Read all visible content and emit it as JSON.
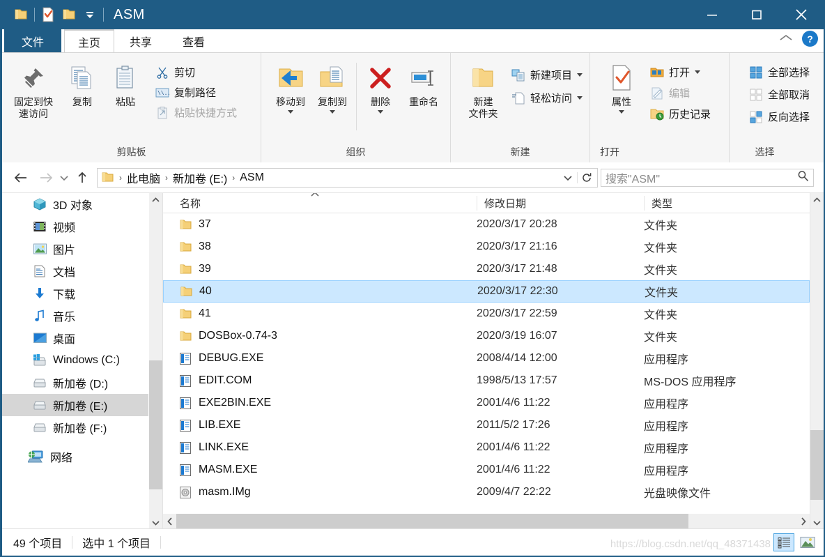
{
  "window": {
    "title": "ASM",
    "quick_access": [
      {
        "name": "folder-icon",
        "label": "属性"
      },
      {
        "name": "properties-icon",
        "label": "属性"
      },
      {
        "name": "new-folder-icon",
        "label": "新建文件夹"
      },
      {
        "name": "customize-qat-icon",
        "label": "自定义快速访问工具栏"
      }
    ],
    "controls": {
      "minimize": "最小化",
      "maximize": "最大化",
      "close": "关闭"
    }
  },
  "tabs": {
    "file": "文件",
    "items": [
      {
        "label": "主页",
        "active": true
      },
      {
        "label": "共享",
        "active": false
      },
      {
        "label": "查看",
        "active": false
      }
    ],
    "collapse_label": "折叠功能区",
    "help_label": "?"
  },
  "ribbon": {
    "groups": [
      {
        "title": "剪贴板",
        "big_buttons": [
          {
            "label": "固定到快\n速访问",
            "line1": "固定到快",
            "line2": "速访问",
            "icon": "pin-icon"
          },
          {
            "label": "复制",
            "line1": "复制",
            "line2": "",
            "icon": "copy-icon"
          },
          {
            "label": "粘贴",
            "line1": "粘贴",
            "line2": "",
            "icon": "paste-icon"
          }
        ],
        "small_buttons": [
          {
            "label": "剪切",
            "icon": "scissors-icon",
            "disabled": false
          },
          {
            "label": "复制路径",
            "icon": "copy-path-icon",
            "disabled": false
          },
          {
            "label": "粘贴快捷方式",
            "icon": "paste-shortcut-icon",
            "disabled": true
          }
        ]
      },
      {
        "title": "组织",
        "big_buttons": [
          {
            "line1": "移动到",
            "line2": "",
            "icon": "move-to-icon",
            "has_caret": true
          },
          {
            "line1": "复制到",
            "line2": "",
            "icon": "copy-to-icon",
            "has_caret": true
          },
          {
            "line1": "删除",
            "line2": "",
            "icon": "delete-icon",
            "has_caret": true
          },
          {
            "line1": "重命名",
            "line2": "",
            "icon": "rename-icon",
            "has_caret": false
          }
        ]
      },
      {
        "title": "新建",
        "big_buttons": [
          {
            "line1": "新建",
            "line2": "文件夹",
            "icon": "new-folder-icon",
            "has_caret": false
          }
        ],
        "small_buttons": [
          {
            "label": "新建项目",
            "icon": "new-item-icon",
            "has_caret": true
          },
          {
            "label": "轻松访问",
            "icon": "easy-access-icon",
            "has_caret": true
          }
        ]
      },
      {
        "title": "打开",
        "big_buttons": [
          {
            "line1": "属性",
            "line2": "",
            "icon": "properties-icon",
            "has_caret": true
          }
        ],
        "small_buttons": [
          {
            "label": "打开",
            "icon": "open-icon",
            "has_caret": true,
            "disabled": false
          },
          {
            "label": "编辑",
            "icon": "edit-icon",
            "has_caret": false,
            "disabled": true
          },
          {
            "label": "历史记录",
            "icon": "history-icon",
            "has_caret": false,
            "disabled": false
          }
        ]
      },
      {
        "title": "选择",
        "small_buttons": [
          {
            "label": "全部选择",
            "icon": "select-all-icon",
            "disabled": false
          },
          {
            "label": "全部取消",
            "icon": "select-none-icon",
            "disabled": true
          },
          {
            "label": "反向选择",
            "icon": "invert-selection-icon",
            "disabled": false
          }
        ]
      }
    ]
  },
  "addressbar": {
    "back_label": "后退",
    "forward_label": "前进",
    "recent_label": "最近浏览的位置",
    "up_label": "上移一级",
    "breadcrumbs": [
      "此电脑",
      "新加卷 (E:)",
      "ASM"
    ],
    "separator": "›",
    "dropdown_label": "先前的位置",
    "refresh_label": "刷新",
    "search_placeholder": "搜索\"ASM\""
  },
  "navpane": {
    "items": [
      {
        "label": "3D 对象",
        "icon": "3d-objects-icon",
        "selected": false
      },
      {
        "label": "视频",
        "icon": "videos-icon",
        "selected": false
      },
      {
        "label": "图片",
        "icon": "pictures-icon",
        "selected": false
      },
      {
        "label": "文档",
        "icon": "documents-icon",
        "selected": false
      },
      {
        "label": "下载",
        "icon": "downloads-icon",
        "selected": false
      },
      {
        "label": "音乐",
        "icon": "music-icon",
        "selected": false
      },
      {
        "label": "桌面",
        "icon": "desktop-icon",
        "selected": false
      },
      {
        "label": "Windows (C:)",
        "icon": "windows-drive-icon",
        "selected": false
      },
      {
        "label": "新加卷 (D:)",
        "icon": "drive-icon",
        "selected": false
      },
      {
        "label": "新加卷 (E:)",
        "icon": "drive-icon",
        "selected": true
      },
      {
        "label": "新加卷 (F:)",
        "icon": "drive-icon",
        "selected": false
      },
      {
        "label": "网络",
        "icon": "network-icon",
        "selected": false,
        "gap_before": true
      }
    ]
  },
  "filelist": {
    "columns": [
      {
        "label": "名称",
        "key": "name"
      },
      {
        "label": "修改日期",
        "key": "date"
      },
      {
        "label": "类型",
        "key": "type"
      }
    ],
    "sort_indicator": "ascending",
    "rows": [
      {
        "name": "37",
        "date": "2020/3/17 20:28",
        "type": "文件夹",
        "icon": "folder-icon",
        "selected": false
      },
      {
        "name": "38",
        "date": "2020/3/17 21:16",
        "type": "文件夹",
        "icon": "folder-icon",
        "selected": false
      },
      {
        "name": "39",
        "date": "2020/3/17 21:48",
        "type": "文件夹",
        "icon": "folder-icon",
        "selected": false
      },
      {
        "name": "40",
        "date": "2020/3/17 22:30",
        "type": "文件夹",
        "icon": "folder-icon",
        "selected": true
      },
      {
        "name": "41",
        "date": "2020/3/17 22:59",
        "type": "文件夹",
        "icon": "folder-icon",
        "selected": false
      },
      {
        "name": "DOSBox-0.74-3",
        "date": "2020/3/19 16:07",
        "type": "文件夹",
        "icon": "folder-icon",
        "selected": false
      },
      {
        "name": "DEBUG.EXE",
        "date": "2008/4/14 12:00",
        "type": "应用程序",
        "icon": "exe-icon",
        "selected": false
      },
      {
        "name": "EDIT.COM",
        "date": "1998/5/13 17:57",
        "type": "MS-DOS 应用程序",
        "icon": "exe-icon",
        "selected": false
      },
      {
        "name": "EXE2BIN.EXE",
        "date": "2001/4/6 11:22",
        "type": "应用程序",
        "icon": "exe-icon",
        "selected": false
      },
      {
        "name": "LIB.EXE",
        "date": "2011/5/2 17:26",
        "type": "应用程序",
        "icon": "exe-icon",
        "selected": false
      },
      {
        "name": "LINK.EXE",
        "date": "2001/4/6 11:22",
        "type": "应用程序",
        "icon": "exe-icon",
        "selected": false
      },
      {
        "name": "MASM.EXE",
        "date": "2001/4/6 11:22",
        "type": "应用程序",
        "icon": "exe-icon",
        "selected": false
      },
      {
        "name": "masm.IMg",
        "date": "2009/4/7 22:22",
        "type": "光盘映像文件",
        "icon": "disc-image-icon",
        "selected": false
      }
    ]
  },
  "statusbar": {
    "item_count": "49 个项目",
    "selection": "选中 1 个项目",
    "views": [
      {
        "name": "details-view",
        "label": "详细信息",
        "active": true
      },
      {
        "name": "large-icons-view",
        "label": "大图标",
        "active": false
      }
    ],
    "watermark": "https://blog.csdn.net/qq_48371438"
  },
  "colors": {
    "titlebar": "#1f5c85",
    "accent": "#1b79c8",
    "selection": "#cce8ff",
    "nav_selection": "#d6d6d6",
    "ribbon_bg": "#f6f6f6"
  }
}
